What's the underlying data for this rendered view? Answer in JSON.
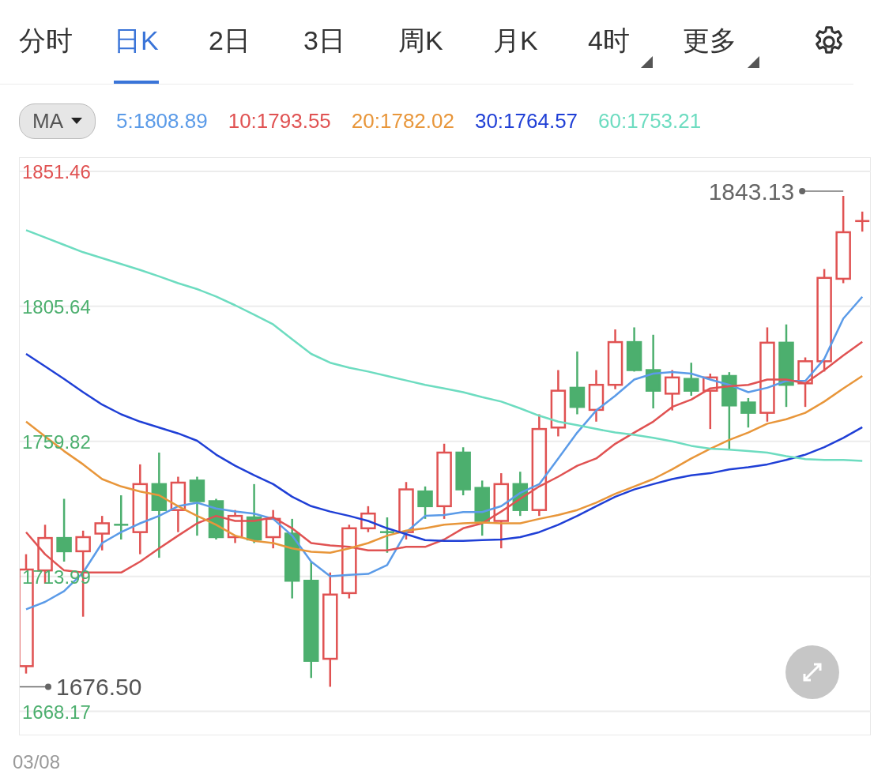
{
  "tabs": [
    {
      "label": "分时",
      "selected": false,
      "has_menu": false
    },
    {
      "label": "日K",
      "selected": true,
      "has_menu": false
    },
    {
      "label": "2日",
      "selected": false,
      "has_menu": false
    },
    {
      "label": "3日",
      "selected": false,
      "has_menu": false
    },
    {
      "label": "周K",
      "selected": false,
      "has_menu": false
    },
    {
      "label": "月K",
      "selected": false,
      "has_menu": false
    },
    {
      "label": "4时",
      "selected": false,
      "has_menu": true
    },
    {
      "label": "更多",
      "selected": false,
      "has_menu": true
    }
  ],
  "indicator_menu": {
    "label": "MA"
  },
  "chart": {
    "chart_data": {
      "type": "candlestick",
      "grid": true,
      "ylim": [
        1660,
        1856
      ],
      "yticks": [
        {
          "value": 1851.46,
          "label": "1851.46"
        },
        {
          "value": 1805.64,
          "label": "1805.64"
        },
        {
          "value": 1759.82,
          "label": "1759.82"
        },
        {
          "value": 1713.99,
          "label": "1713.99"
        },
        {
          "value": 1668.17,
          "label": "1668.17"
        }
      ],
      "ohlc": [
        [
          1683.5,
          1721.5,
          1681,
          1716.3
        ],
        [
          1716,
          1731.5,
          1711.5,
          1727
        ],
        [
          1727,
          1740.3,
          1719,
          1722.5
        ],
        [
          1722.5,
          1729.5,
          1700.3,
          1727.3
        ],
        [
          1728.5,
          1734.5,
          1722.8,
          1732
        ],
        [
          1731.5,
          1741.5,
          1726.5,
          1731.4
        ],
        [
          1729,
          1752,
          1721.5,
          1745.3
        ],
        [
          1745.3,
          1756,
          1720.3,
          1736.5
        ],
        [
          1736.5,
          1747.8,
          1729,
          1745.8
        ],
        [
          1746.5,
          1747.8,
          1727.8,
          1739.5
        ],
        [
          1739.5,
          1740.3,
          1726.5,
          1727.3
        ],
        [
          1727.3,
          1736.5,
          1725.3,
          1734.5
        ],
        [
          1734,
          1745.3,
          1725.3,
          1726.5
        ],
        [
          1727.3,
          1736.5,
          1723.5,
          1733.5
        ],
        [
          1728.5,
          1733.5,
          1706.5,
          1712.5
        ],
        [
          1712.5,
          1719,
          1679.5,
          1685.3
        ],
        [
          1686,
          1715.3,
          1676.5,
          1707.8
        ],
        [
          1708.3,
          1731.5,
          1706.5,
          1730.3
        ],
        [
          1730.3,
          1737.8,
          1729,
          1735.3
        ],
        [
          1729,
          1734,
          1722,
          1728.9
        ],
        [
          1729,
          1746,
          1726.5,
          1743.5
        ],
        [
          1742.8,
          1744.5,
          1733.5,
          1737.8
        ],
        [
          1737.8,
          1759,
          1733.5,
          1756
        ],
        [
          1756,
          1757.8,
          1741.5,
          1743.5
        ],
        [
          1744,
          1746.5,
          1727.8,
          1732.8
        ],
        [
          1732.8,
          1749,
          1723.5,
          1745.3
        ],
        [
          1745.3,
          1749.5,
          1734.5,
          1736.5
        ],
        [
          1736.5,
          1769,
          1734.5,
          1764
        ],
        [
          1764.5,
          1784,
          1761.5,
          1777
        ],
        [
          1778,
          1790.3,
          1769,
          1771.5
        ],
        [
          1770.5,
          1784,
          1766.5,
          1779
        ],
        [
          1779,
          1797.8,
          1777.5,
          1793.5
        ],
        [
          1793.5,
          1798.5,
          1783.5,
          1784
        ],
        [
          1784,
          1796,
          1771,
          1777
        ],
        [
          1776,
          1784,
          1770.3,
          1781.5
        ],
        [
          1781,
          1786.5,
          1775.3,
          1777
        ],
        [
          1777,
          1782.8,
          1764,
          1781.5
        ],
        [
          1782,
          1783.3,
          1757,
          1772
        ],
        [
          1773,
          1774.5,
          1764.5,
          1769.5
        ],
        [
          1769.5,
          1798.5,
          1766.5,
          1793.3
        ],
        [
          1793.3,
          1799.5,
          1771.5,
          1779
        ],
        [
          1779.5,
          1788.3,
          1771.5,
          1787
        ],
        [
          1787,
          1818.3,
          1783.5,
          1815.3
        ],
        [
          1815,
          1843.13,
          1813.5,
          1830.8
        ],
        [
          1834.4,
          1837.8,
          1831,
          1834.6
        ]
      ],
      "series": [
        {
          "name": "5:1808.89",
          "type": "line",
          "color": "#5b9be8",
          "values": [
            1702.8,
            1705.3,
            1709,
            1715.3,
            1725.3,
            1729,
            1732,
            1734.5,
            1737.8,
            1739,
            1737,
            1736,
            1735.3,
            1733.5,
            1727.8,
            1719,
            1714,
            1714.5,
            1714.8,
            1717.8,
            1729,
            1734.5,
            1734.8,
            1735.8,
            1735.8,
            1737.8,
            1742.3,
            1745.3,
            1754,
            1762.8,
            1770.3,
            1775.3,
            1780.8,
            1782.8,
            1783.3,
            1782.8,
            1780.8,
            1779,
            1776.5,
            1778,
            1780.3,
            1780.3,
            1787.8,
            1801.5,
            1808.9
          ]
        },
        {
          "name": "10:1793.55",
          "type": "line",
          "color": "#e05252",
          "values": [
            1729,
            1721.5,
            1716,
            1715.3,
            1715.3,
            1715.3,
            1719,
            1723.5,
            1727.8,
            1732,
            1734.5,
            1732.8,
            1732.8,
            1734,
            1730.3,
            1725.3,
            1724.5,
            1724,
            1722.8,
            1722.8,
            1724,
            1724,
            1726.5,
            1730.3,
            1732,
            1736,
            1740.3,
            1744.5,
            1747.8,
            1751.5,
            1754,
            1759,
            1762.8,
            1766.5,
            1771.5,
            1774,
            1777.8,
            1778.5,
            1779,
            1780.8,
            1780.8,
            1779.5,
            1784,
            1789,
            1793.6
          ]
        },
        {
          "name": "20:1782.02",
          "type": "line",
          "color": "#e8963a",
          "values": [
            1766.5,
            1761.5,
            1756.5,
            1752,
            1747,
            1744.5,
            1742.8,
            1741.5,
            1737.8,
            1734.5,
            1731.5,
            1727.8,
            1726,
            1725.3,
            1723.5,
            1722.3,
            1722,
            1723.5,
            1725.3,
            1727.8,
            1729.5,
            1730.3,
            1731.5,
            1732,
            1732.3,
            1732,
            1732,
            1733.5,
            1734.8,
            1736.5,
            1739,
            1742,
            1744.5,
            1747,
            1750.3,
            1754,
            1757.3,
            1760.3,
            1762.8,
            1765.8,
            1767.3,
            1769.5,
            1773.3,
            1777.8,
            1782
          ]
        },
        {
          "name": "30:1764.57",
          "type": "line",
          "color": "#1f3fd6",
          "values": [
            1789.5,
            1785.3,
            1781,
            1776.5,
            1772.3,
            1769,
            1766.5,
            1764.5,
            1762.5,
            1760,
            1755.3,
            1751.5,
            1748.3,
            1745.3,
            1741,
            1737.8,
            1736,
            1734.5,
            1732.8,
            1730.3,
            1728.3,
            1726.3,
            1726,
            1726,
            1726.3,
            1726.5,
            1727.3,
            1729,
            1731.5,
            1734.5,
            1737.8,
            1741,
            1743.5,
            1745.3,
            1747,
            1748.3,
            1749,
            1750.3,
            1751,
            1752,
            1753.5,
            1755.3,
            1757.8,
            1761,
            1764.6
          ]
        },
        {
          "name": "60:1753.21",
          "type": "line",
          "color": "#6ddcc0",
          "values": [
            1831.5,
            1829,
            1826.5,
            1824,
            1822,
            1820,
            1818,
            1815.8,
            1813.5,
            1811.5,
            1809,
            1806,
            1802.8,
            1799.5,
            1794.5,
            1789.5,
            1786.5,
            1784.8,
            1783.5,
            1782,
            1780.5,
            1779,
            1777.8,
            1776.5,
            1774.8,
            1773.3,
            1771,
            1768.5,
            1766.5,
            1765.3,
            1764,
            1762.8,
            1762,
            1761,
            1759.8,
            1758.3,
            1757.3,
            1757,
            1756.5,
            1756,
            1754.8,
            1753.8,
            1753.5,
            1753.5,
            1753.2
          ]
        }
      ],
      "annotations": [
        "1843.13",
        "1676.50"
      ]
    }
  },
  "axis_start_date": "03/08"
}
